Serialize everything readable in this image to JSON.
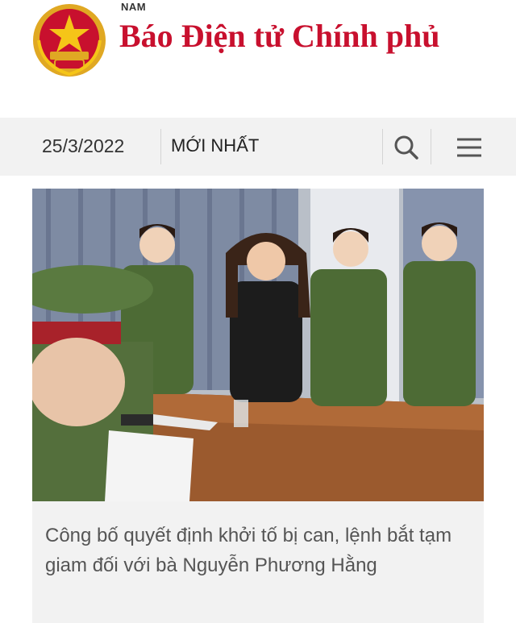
{
  "header": {
    "small_title": "NAM",
    "site_title": "Báo Điện tử Chính phủ",
    "emblem_icon": "national-emblem-icon"
  },
  "navbar": {
    "date": "25/3/2022",
    "latest_label": "MỚI NHẤT",
    "search_icon": "search-icon",
    "menu_icon": "hamburger-menu-icon"
  },
  "article": {
    "image": "news-photo",
    "caption": "Công bố quyết định khởi tố bị can, lệnh bắt tạm giam đối với bà Nguyễn Phương Hằng"
  },
  "colors": {
    "brand_red": "#c8102e",
    "navbar_bg": "#f2f2f2",
    "caption_text": "#555555"
  }
}
